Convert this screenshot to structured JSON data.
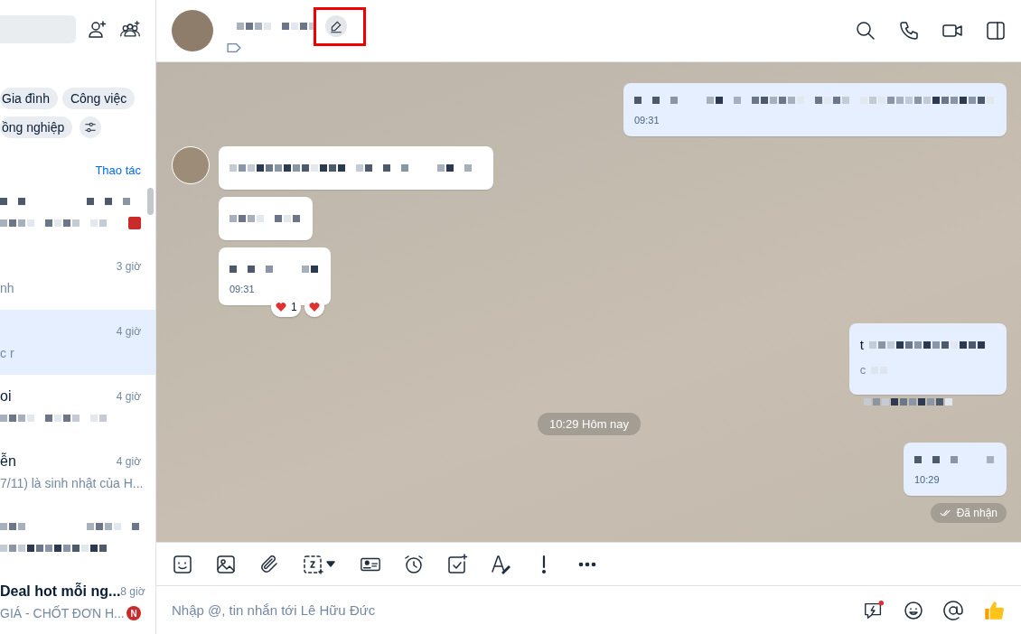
{
  "sidebar": {
    "filter_tags": [
      {
        "label": "Gia đình"
      },
      {
        "label": "Công việc"
      },
      {
        "label": "ồng nghiệp"
      }
    ],
    "action_link": "Thao tác",
    "conversations": [
      {
        "selected": false,
        "unread": true
      },
      {
        "preview": "nh",
        "time": "3 giờ",
        "selected": false
      },
      {
        "preview": "c r",
        "time": "4 giờ",
        "selected": true
      },
      {
        "name": "oi",
        "time": "4 giờ",
        "selected": false
      },
      {
        "name": "ễn",
        "time": "4 giờ",
        "preview": "7/11) là sinh nhật của H...",
        "selected": false
      },
      {
        "selected": false
      },
      {
        "name": "Deal hot mỗi ng...",
        "time": "8 giờ",
        "preview": "GIÁ - CHỐT ĐƠN H...",
        "selected": false,
        "badge": "N"
      }
    ]
  },
  "chat": {
    "messages": [
      {
        "kind": "out",
        "time": "09:31"
      },
      {
        "kind": "in",
        "avatar": true
      },
      {
        "kind": "in"
      },
      {
        "kind": "in",
        "time": "09:31",
        "reactions": [
          {
            "kind": "heart",
            "count": "1"
          },
          {
            "kind": "heart"
          }
        ]
      },
      {
        "kind": "out",
        "lead": "t",
        "second_lead": "c"
      },
      {
        "kind": "date",
        "label": "10:29 Hôm nay"
      },
      {
        "kind": "out",
        "time": "10:29"
      },
      {
        "kind": "status",
        "label": "Đã nhận"
      }
    ]
  },
  "composer": {
    "placeholder": "Nhập @, tin nhắn tới Lê Hữu Đức"
  }
}
